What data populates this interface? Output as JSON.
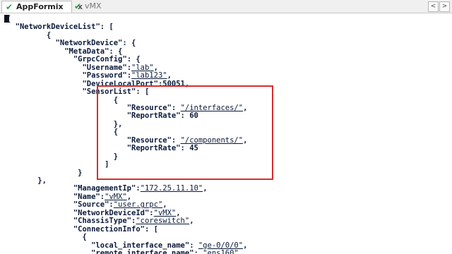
{
  "tabs": [
    {
      "label": "AppFormix",
      "close": "x",
      "active": true
    },
    {
      "label": "vMX",
      "close": "",
      "active": false
    }
  ],
  "scroll": {
    "left": "<",
    "right": ">"
  },
  "editor": {
    "lines": [
      "{",
      "  \"NetworkDeviceList\": [",
      "         {",
      "           \"NetworkDevice\": {",
      "             \"MetaData\": {",
      "               \"GrpcConfig\": {",
      "                 \"Username\":\"lab\",",
      "                 \"Password\":\"lab123\",",
      "                 \"DeviceLocalPort\":50051,",
      "                 \"SensorList\": [",
      "                        {",
      "                           \"Resource\": \"/interfaces/\",",
      "                           \"ReportRate\": 60",
      "                        },",
      "                        {",
      "                           \"Resource\": \"/components/\",",
      "                           \"ReportRate\": 45",
      "                        }",
      "                      ]",
      "                }",
      "       },",
      "               \"ManagementIp\":\"172.25.11.10\",",
      "               \"Name\":\"vMX\",",
      "               \"Source\":\"user.grpc\",",
      "               \"NetworkDeviceId\":\"vMX\",",
      "               \"ChassisType\":\"coreswitch\",",
      "               \"ConnectionInfo\": [",
      "                 {",
      "                   \"local_interface_name\": \"ge-0/0/0\",",
      "                   \"remote_interface_name\": \"ens160\","
    ]
  }
}
